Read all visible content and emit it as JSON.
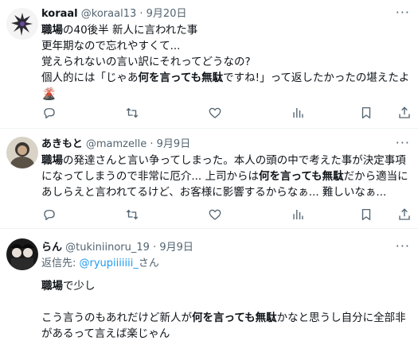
{
  "tweets": [
    {
      "name": "koraal",
      "handle": "@koraal13",
      "dot": "·",
      "date": "9月20日",
      "more": "···",
      "lines": [
        [
          {
            "t": "職場",
            "b": true
          },
          {
            "t": "の40後半 新人に言われた事",
            "b": false
          }
        ],
        [
          {
            "t": "更年期なので忘れやすくて...",
            "b": false
          }
        ],
        [
          {
            "t": "覚えられないの言い訳にそれってどうなの?",
            "b": false
          }
        ],
        [
          {
            "t": "個人的には「じゃあ",
            "b": false
          },
          {
            "t": "何を言っても無駄",
            "b": true
          },
          {
            "t": "ですね!」って返したかったの堪えたよ",
            "b": false
          }
        ]
      ],
      "emoji": "🌋"
    },
    {
      "name": "あきもと",
      "handle": "@mamzelle",
      "dot": "·",
      "date": "9月9日",
      "more": "···",
      "lines": [
        [
          {
            "t": "職場",
            "b": true
          },
          {
            "t": "の発達さんと言い争ってしまった。本人の頭の中で考えた事が決定事項",
            "b": false
          }
        ],
        [
          {
            "t": "になってしまうので非常に厄介... 上司からは",
            "b": false
          },
          {
            "t": "何を言っても無駄",
            "b": true
          },
          {
            "t": "だから適当に",
            "b": false
          }
        ],
        [
          {
            "t": "あしらえと言われてるけど、お客様に影響するからなぁ... 難しいなぁ...",
            "b": false
          }
        ]
      ]
    },
    {
      "name": "らん",
      "handle": "@tukiniinoru_19",
      "dot": "·",
      "date": "9月9日",
      "more": "···",
      "reply_prefix": "返信先: ",
      "reply_mention": "@ryupiiiiiii_",
      "reply_suffix": "さん",
      "lines": [
        [
          {
            "t": "職場",
            "b": true
          },
          {
            "t": "で少し",
            "b": false
          }
        ],
        [
          {
            "t": "",
            "b": false
          }
        ],
        [
          {
            "t": "こう言うのもあれだけど新人が",
            "b": false
          },
          {
            "t": "何を言っても無駄",
            "b": true
          },
          {
            "t": "かなと思うし自分に全部非",
            "b": false
          }
        ],
        [
          {
            "t": "があるって言えば楽じゃん",
            "b": false
          }
        ]
      ]
    }
  ],
  "icons": [
    "reply-icon",
    "retweet-icon",
    "like-icon",
    "views-icon",
    "bookmark-icon",
    "share-icon"
  ],
  "colors": {
    "text": "#0f1419",
    "secondary": "#536471",
    "link": "#1d9bf0",
    "divider": "#eff3f4"
  }
}
